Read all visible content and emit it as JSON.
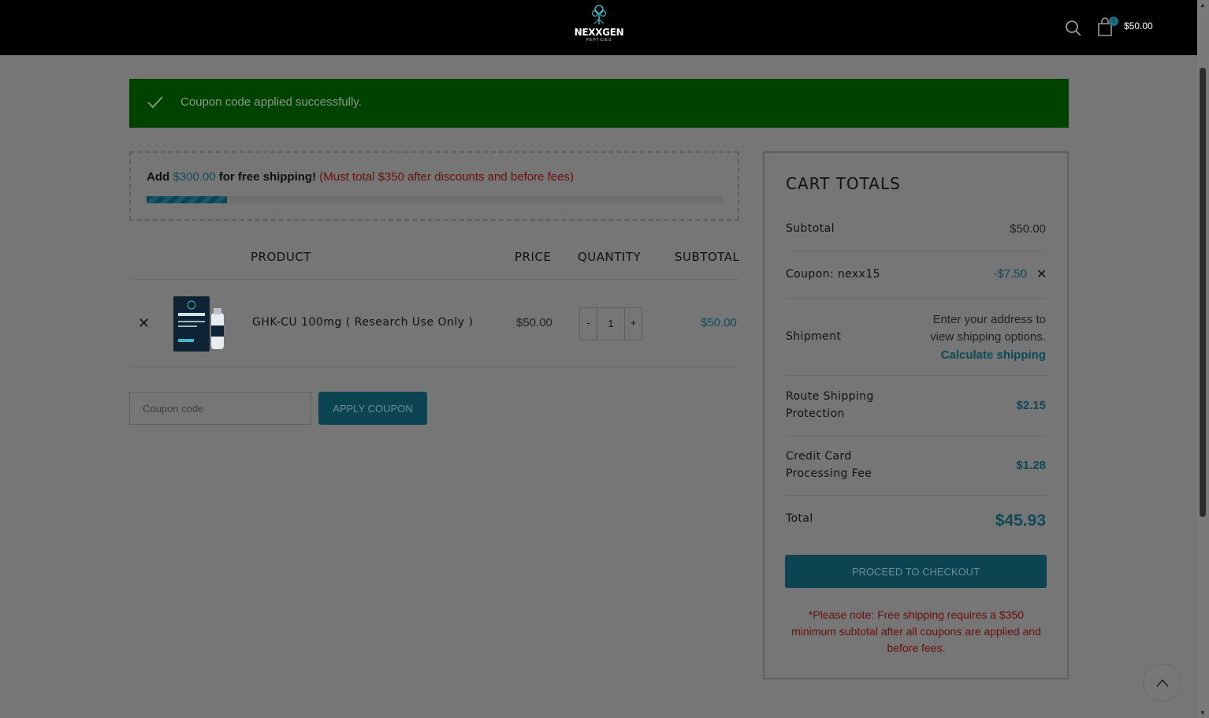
{
  "header": {
    "logo_text": "NEXXGEN",
    "logo_sub": "PEPTIDES",
    "cart_count": "1",
    "cart_total": "$50.00"
  },
  "notice": {
    "message": "Coupon code applied successfully."
  },
  "free_shipping": {
    "prefix": "Add",
    "amount": "$300.00",
    "suffix": "for free shipping!",
    "warning": "(Must total $350 after discounts and before fees)",
    "progress": 0.14
  },
  "table": {
    "headers": [
      "PRODUCT",
      "PRICE",
      "QUANTITY",
      "SUBTOTAL"
    ],
    "rows": [
      {
        "name": "GHK-CU 100mg ( Research Use Only )",
        "price": "$50.00",
        "quantity": "1",
        "subtotal": "$50.00",
        "qty_minus": "-",
        "qty_plus": "+"
      }
    ]
  },
  "coupon": {
    "placeholder": "Coupon code",
    "apply_label": "APPLY COUPON"
  },
  "totals": {
    "title": "CART TOTALS",
    "subtotal_label": "Subtotal",
    "subtotal_value": "$50.00",
    "coupon_label": "Coupon: nexx15",
    "coupon_value": "-$7.50",
    "shipment_label": "Shipment",
    "shipment_line1": "Enter your address to",
    "shipment_line2": "view shipping options.",
    "calculate_link": "Calculate shipping",
    "route_label_1": "Route Shipping",
    "route_label_2": "Protection",
    "route_value": "$2.15",
    "cc_label_1": "Credit Card",
    "cc_label_2": "Processing Fee",
    "cc_value": "$1.28",
    "total_label": "Total",
    "total_value": "$45.93",
    "checkout_label": "PROCEED TO CHECKOUT",
    "note": "*Please note: Free shipping requires a $350 minimum subtotal after all coupons are applied and before fees."
  },
  "colors": {
    "accent": "#0d4452",
    "success": "#004300",
    "warning": "#6a0e0e"
  },
  "icons": [
    "search-icon",
    "cart-icon",
    "check-icon",
    "close-icon",
    "chevron-up-icon"
  ]
}
